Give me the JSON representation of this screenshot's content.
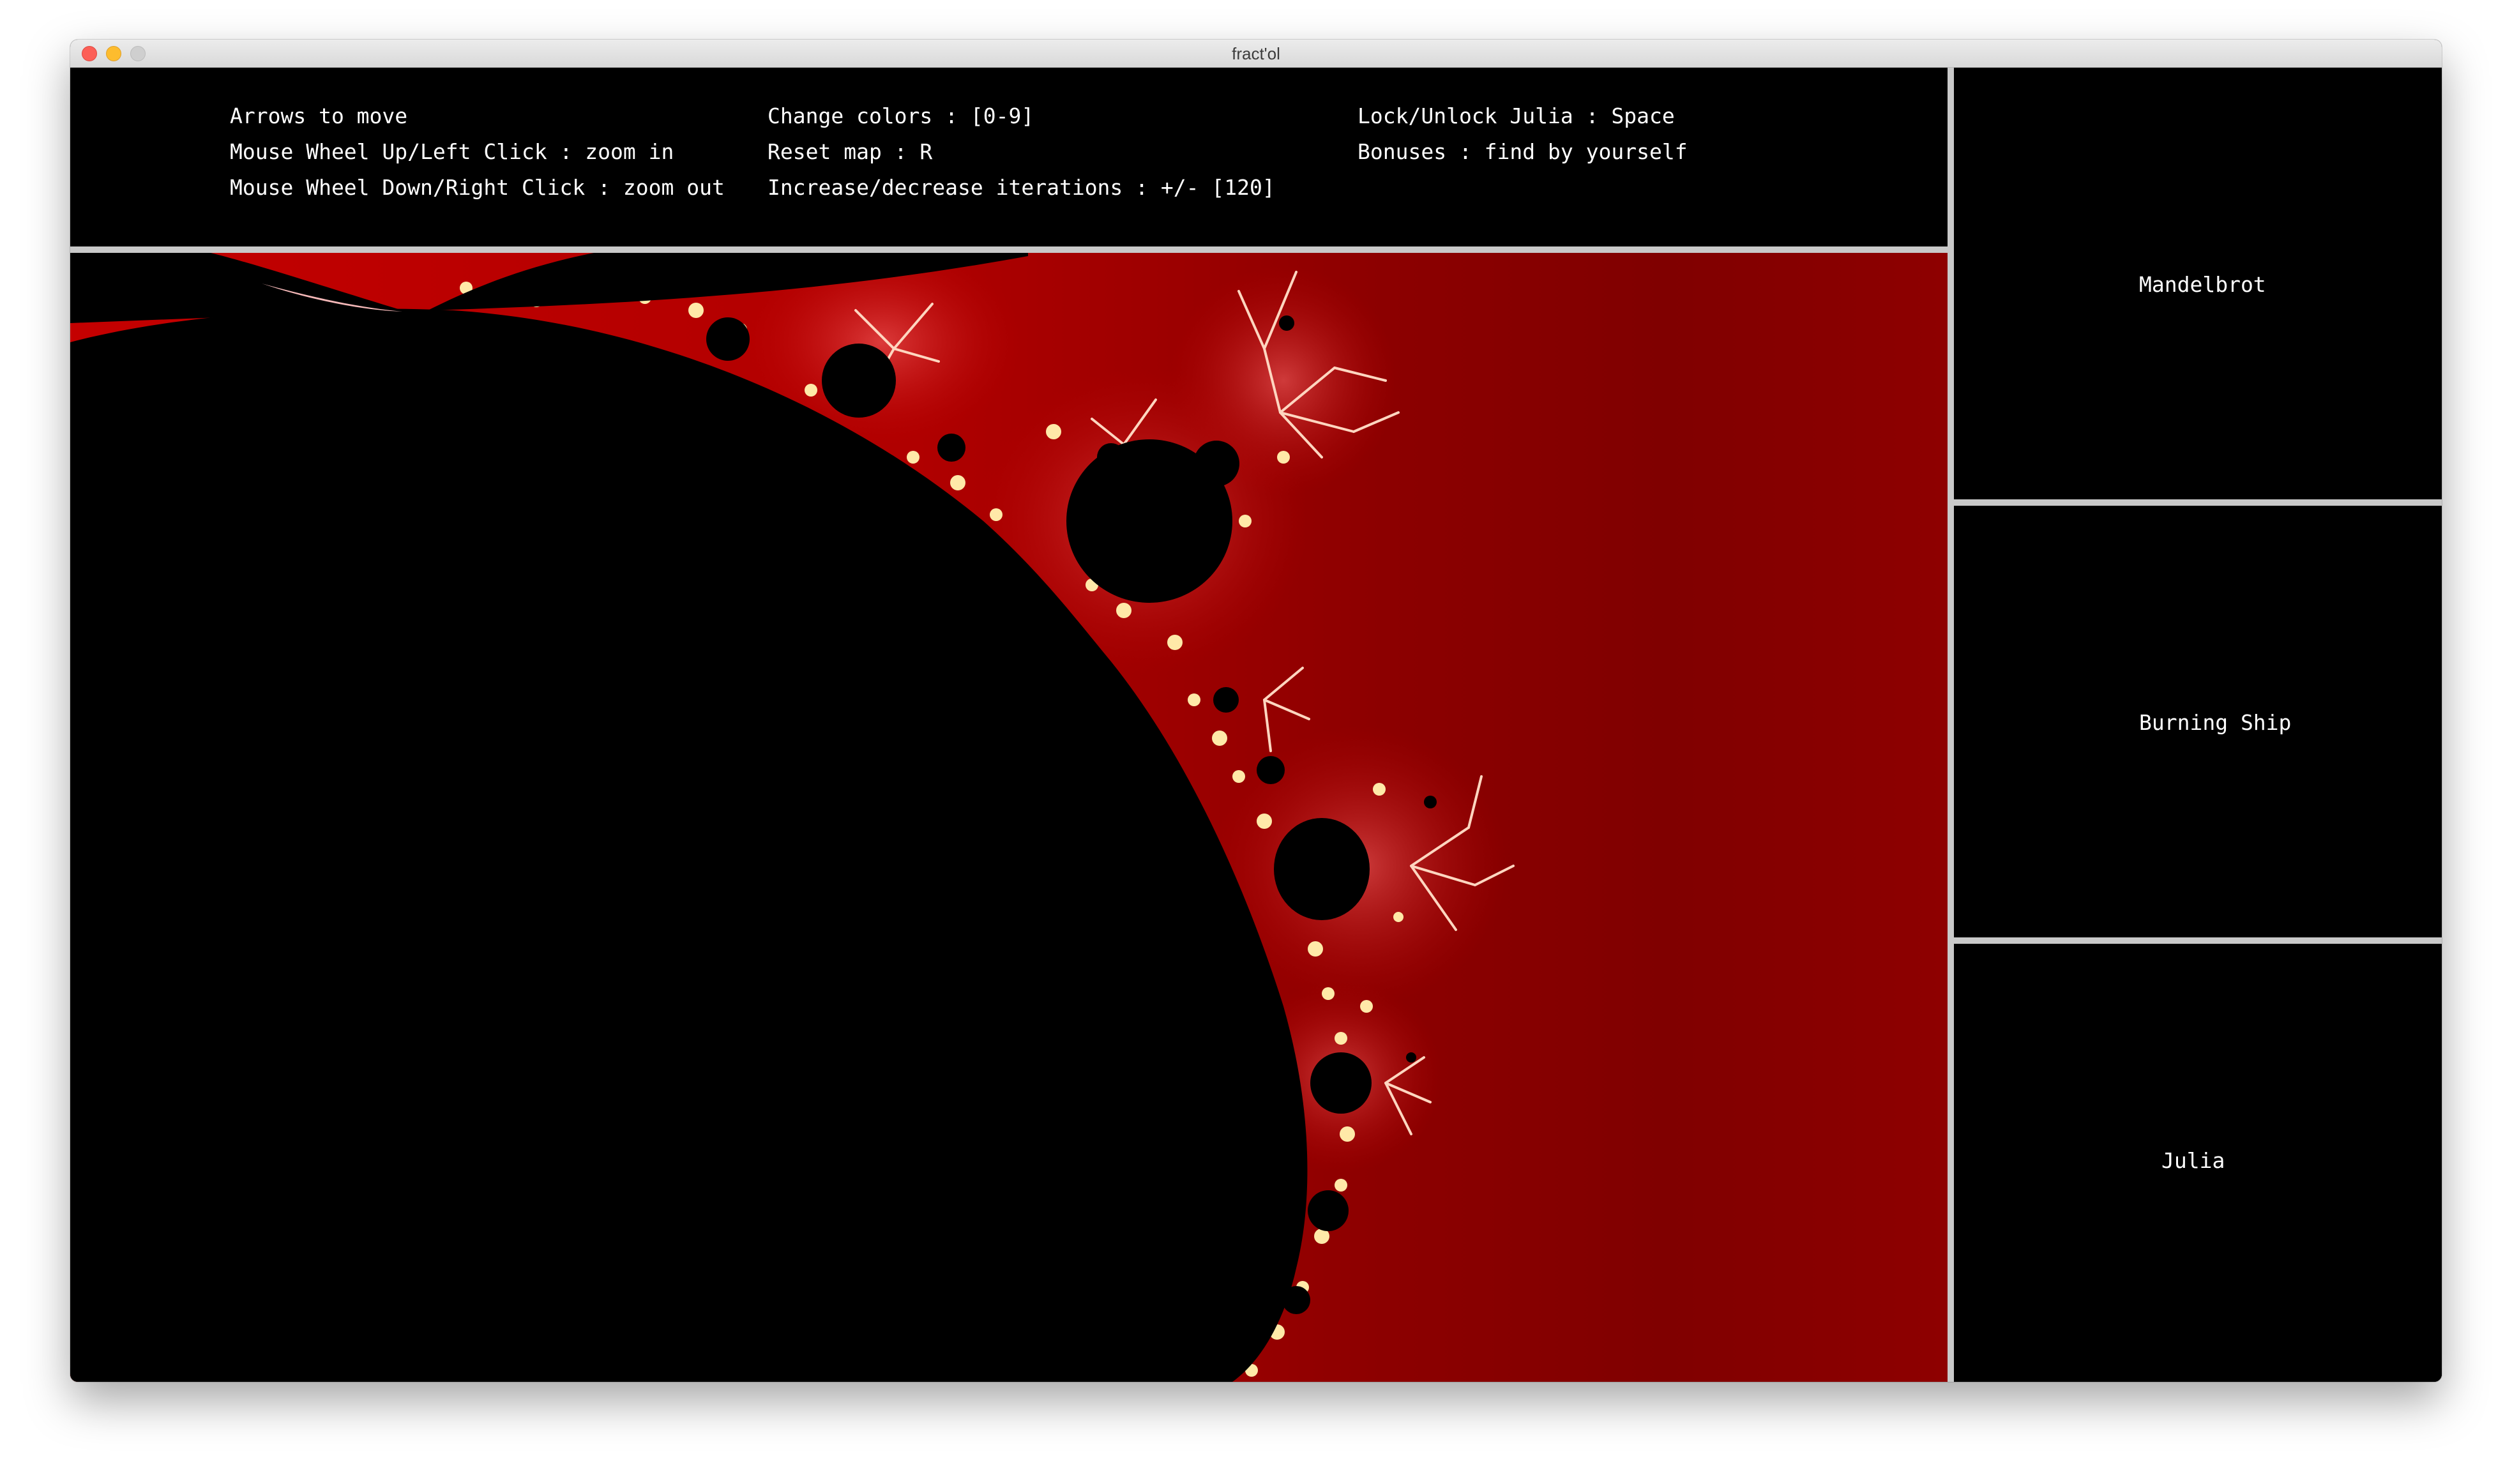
{
  "window": {
    "title": "fract'ol"
  },
  "help": {
    "columns": [
      [
        "Arrows to move",
        "Mouse Wheel Up/Left Click : zoom in",
        "Mouse Wheel Down/Right Click : zoom out"
      ],
      [
        "Change colors : [0-9]",
        "Reset map : R",
        "Increase/decrease iterations : +/- [120]"
      ],
      [
        "Lock/Unlock Julia : Space",
        "Bonuses : find by yourself"
      ]
    ]
  },
  "fractals": [
    {
      "label": "Mandelbrot"
    },
    {
      "label": "Burning Ship"
    },
    {
      "label": "Julia"
    }
  ],
  "colors": {
    "background": "#000000",
    "fractal_red": "#c00000",
    "fractal_dark_red": "#8a0000",
    "divider": "#c9c9c9"
  },
  "icons": {
    "close": "close-icon",
    "minimize": "minimize-icon",
    "maximize": "maximize-icon"
  }
}
